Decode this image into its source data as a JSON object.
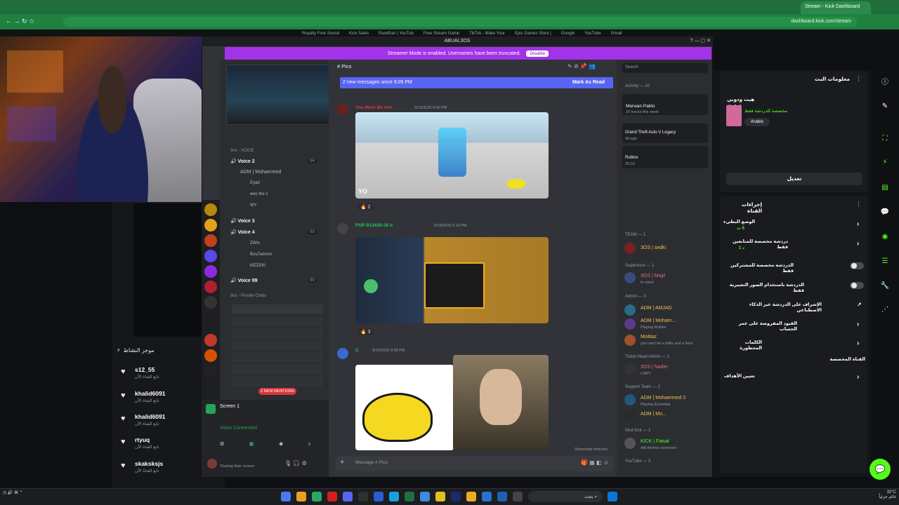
{
  "browser": {
    "active_tab": "Stream - Kick Dashboard",
    "url": "dashboard.kick.com/stream",
    "bookmarks": [
      "Royalty Free Sound",
      "Kick Sales",
      "Randfran | YouTub",
      "Free Stream Game",
      "TikTok - Make Your",
      "Epic Games Store |",
      "Google",
      "YouTube",
      "Gmail"
    ]
  },
  "discord": {
    "window_title": "ABUAL3OS",
    "banner_text": "Streamer Mode is enabled. Usernames have been truncated.",
    "disable_label": "Disable",
    "channel_header": "Pics",
    "new_messages": "2 new messages since 9:09 PM",
    "mark_as_read": "Mark As Read",
    "voice_section": "3os - VOICE",
    "channels": [
      {
        "name": "Voice 2",
        "count": "04"
      },
      {
        "name": "Voice 3",
        "count": ""
      },
      {
        "name": "Voice 4",
        "count": "03"
      },
      {
        "name": "Voice 99",
        "count": "99"
      }
    ],
    "voice_users_v2": [
      "ADM | Mohammed",
      "Eyad",
      "wes the z",
      "WY"
    ],
    "voice_users_v4": [
      "ZWin",
      "Bou7amron",
      "MZZEKI"
    ],
    "private_section": "3os - Private Chats",
    "mention_badge": "2 NEW MENTIONS",
    "screen_label": "Screen 1",
    "voice_connected": "Voice Connected",
    "sharing": "Sharing their screen",
    "messages": [
      {
        "author": "You Must Be Ven",
        "time": "9/19/2025 8:56 PM",
        "reaction": "2"
      },
      {
        "author": "PSR B12620-26 b",
        "time": "9/19/2025 9:16 PM",
        "reaction": "3"
      },
      {
        "author": "C",
        "time": "9/19/2025 9:58 PM"
      }
    ],
    "composer_placeholder": "Message # Pics",
    "slowmode": "Slowmode immune"
  },
  "members": {
    "search_placeholder": "Search",
    "activity_header": "Activity — 10",
    "activities": [
      {
        "name": "Marwan Pablo",
        "sub": "20 tracks this week"
      },
      {
        "name": "Grand Theft Auto V Legacy",
        "sub": "4d ago"
      },
      {
        "name": "Roblox",
        "sub": "26:03"
      }
    ],
    "groups": [
      {
        "header": "TEAM — 1",
        "name": "3OS | sedki"
      },
      {
        "header": "Supervisor — 1",
        "name": "3OS | Majd",
        "sub": "In voice"
      },
      {
        "header": "Admin — 3",
        "name": "ADM | AMJAD"
      },
      {
        "header": "",
        "name": "ADM | Moham...",
        "sub": "Playing Roblox"
      },
      {
        "header": "",
        "name": "Moãtaz",
        "sub": "you can't be a killer and a hero"
      },
      {
        "header": "Ticket Head Admin — 1",
        "name": "3OS | Nader",
        "sub": "CAPY"
      },
      {
        "header": "Support Team — 2",
        "name": "ADM | Mohammed 3",
        "sub": "Playing Essential"
      },
      {
        "header": "",
        "name": "ADM | Mo..."
      },
      {
        "header": "Mod kick — 1",
        "name": "KICK | Faisal",
        "sub": "will destroy everyone"
      },
      {
        "header": "YouTube — 3",
        "name": ""
      }
    ]
  },
  "feed": {
    "title": "موجز النشاط",
    "items": [
      {
        "name": "s12_55",
        "sub": "تابع القناة الآن"
      },
      {
        "name": "khalid6091",
        "sub": "تابع القناة الآن"
      },
      {
        "name": "khalid6091",
        "sub": "تابع القناة الآن"
      },
      {
        "name": "rtyuq",
        "sub": "تابع القناة الآن"
      },
      {
        "name": "skaksksjs",
        "sub": "تابع القناة الآن"
      }
    ]
  },
  "kick": {
    "stream_info_title": "معلومات البث",
    "stream_title": "هيت ودويي صديث",
    "stream_tag": "مخصصة للدردشة فقط",
    "language": "Arabic",
    "edit_button": "تعديل",
    "channel_actions_title": "إجراءات القناة",
    "rows": [
      {
        "label": "الوضع البطيء",
        "sub": "5 ث",
        "control": "chevron"
      },
      {
        "label": "دردشة مخصصة للمتابعين فقط",
        "sub": "د 1",
        "control": "chevron"
      },
      {
        "label": "الدردشة مخصصة للمشتركين فقط",
        "control": "toggle"
      },
      {
        "label": "الدردشة باستخدام الصور التعبيرية فقط",
        "control": "toggle"
      },
      {
        "label": "الإشراف على الدردشة عبر الذكاء الاصطناعي",
        "control": "external"
      },
      {
        "label": "القيود المفروضة على عمر الحساب",
        "control": "chevron"
      },
      {
        "label": "الكلمات المحظورة",
        "control": "chevron"
      },
      {
        "label": "القناة المخصصة",
        "control": "none"
      },
      {
        "label": "تعيين الأهداف",
        "control": "chevron"
      }
    ]
  },
  "taskbar": {
    "search": "بحث",
    "weather": "32°C",
    "weather_sub": "غائم جزئياً"
  },
  "colors": {
    "kick_green": "#53fc18",
    "discord_blurple": "#5865f2",
    "streamer_purple": "#a233e8"
  }
}
